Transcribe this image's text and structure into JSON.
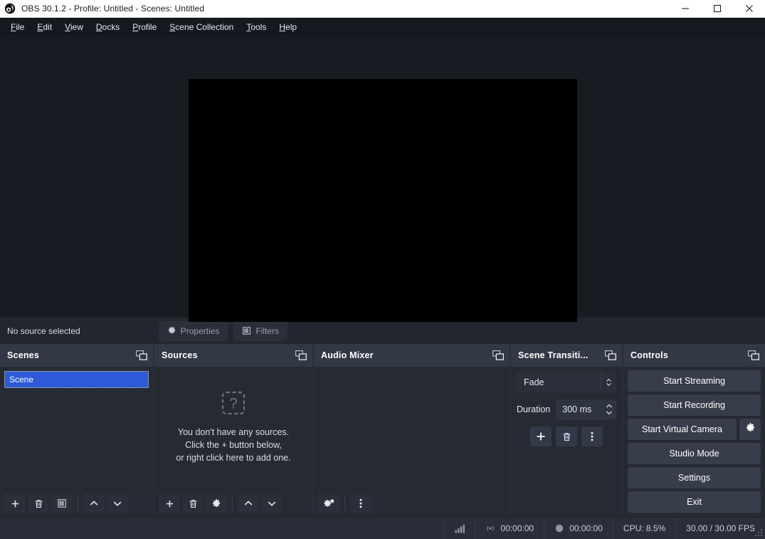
{
  "window": {
    "title": "OBS 30.1.2 - Profile: Untitled - Scenes: Untitled",
    "logo_icon": "obs-logo-icon",
    "minimize_icon": "minimize-icon",
    "maximize_icon": "maximize-icon",
    "close_icon": "close-icon"
  },
  "menubar": {
    "items": [
      {
        "label": "File",
        "mnemonic": "F",
        "rest": "ile"
      },
      {
        "label": "Edit",
        "mnemonic": "E",
        "rest": "dit"
      },
      {
        "label": "View",
        "mnemonic": "V",
        "rest": "iew"
      },
      {
        "label": "Docks",
        "mnemonic": "D",
        "rest": "ocks"
      },
      {
        "label": "Profile",
        "mnemonic": "P",
        "rest": "rofile"
      },
      {
        "label": "Scene Collection",
        "mnemonic": "S",
        "rest": "cene Collection"
      },
      {
        "label": "Tools",
        "mnemonic": "T",
        "rest": "ools"
      },
      {
        "label": "Help",
        "mnemonic": "H",
        "rest": "elp"
      }
    ]
  },
  "preview": {
    "canvas_color": "#000000",
    "background_color": "#181b22"
  },
  "source_toolbar": {
    "status_text": "No source selected",
    "properties_label": "Properties",
    "properties_icon": "gear-icon",
    "filters_label": "Filters",
    "filters_icon": "filters-icon"
  },
  "docks": {
    "scenes": {
      "title": "Scenes",
      "float_icon": "undock-icon",
      "items": [
        {
          "name": "Scene",
          "selected": true
        }
      ],
      "toolbar": [
        {
          "icon": "plus-icon",
          "name": "add-scene-button"
        },
        {
          "icon": "trash-icon",
          "name": "remove-scene-button"
        },
        {
          "icon": "filters-icon",
          "name": "scene-filters-button"
        },
        {
          "icon": "chevron-up-icon",
          "name": "move-scene-up-button"
        },
        {
          "icon": "chevron-down-icon",
          "name": "move-scene-down-button"
        }
      ]
    },
    "sources": {
      "title": "Sources",
      "float_icon": "undock-icon",
      "empty_icon": "question-mark-icon",
      "empty_lines": [
        "You don't have any sources.",
        "Click the + button below,",
        "or right click here to add one."
      ],
      "toolbar": [
        {
          "icon": "plus-icon",
          "name": "add-source-button"
        },
        {
          "icon": "trash-icon",
          "name": "remove-source-button"
        },
        {
          "icon": "gear-icon",
          "name": "source-properties-button"
        },
        {
          "icon": "chevron-up-icon",
          "name": "move-source-up-button"
        },
        {
          "icon": "chevron-down-icon",
          "name": "move-source-down-button"
        }
      ]
    },
    "audio_mixer": {
      "title": "Audio Mixer",
      "float_icon": "undock-icon",
      "toolbar": [
        {
          "icon": "audio-settings-icon",
          "name": "audio-advanced-properties-button"
        },
        {
          "icon": "kebab-menu-icon",
          "name": "audio-mixer-menu-button"
        }
      ]
    },
    "scene_transitions": {
      "title": "Scene Transiti...",
      "full_title": "Scene Transitions",
      "float_icon": "undock-icon",
      "transition_value": "Fade",
      "duration_label": "Duration",
      "duration_value": "300 ms",
      "toolbar": [
        {
          "icon": "plus-icon",
          "name": "add-transition-button"
        },
        {
          "icon": "trash-icon",
          "name": "remove-transition-button"
        },
        {
          "icon": "kebab-menu-icon",
          "name": "transition-properties-button"
        }
      ]
    },
    "controls": {
      "title": "Controls",
      "float_icon": "undock-icon",
      "buttons": [
        {
          "label": "Start Streaming",
          "name": "start-streaming-button"
        },
        {
          "label": "Start Recording",
          "name": "start-recording-button"
        },
        {
          "label": "Start Virtual Camera",
          "name": "start-virtual-camera-button"
        },
        {
          "label": "Studio Mode",
          "name": "studio-mode-button"
        },
        {
          "label": "Settings",
          "name": "settings-button"
        },
        {
          "label": "Exit",
          "name": "exit-button"
        }
      ],
      "virtual_camera_gear_icon": "gear-icon"
    }
  },
  "statusbar": {
    "signal_icon": "signal-bars-icon",
    "stream_icon": "broadcast-icon",
    "stream_time": "00:00:00",
    "record_icon": "record-dot-icon",
    "record_time": "00:00:00",
    "cpu": "CPU: 8.5%",
    "fps": "30.00 / 30.00 FPS",
    "grip_icon": "resize-grip-icon"
  },
  "colors": {
    "accent_selected": "#2d5bd7",
    "dock_header": "#323845",
    "dock_body": "#262a33",
    "window_bg": "#2a2e38",
    "titlebar_bg": "#ffffff"
  }
}
